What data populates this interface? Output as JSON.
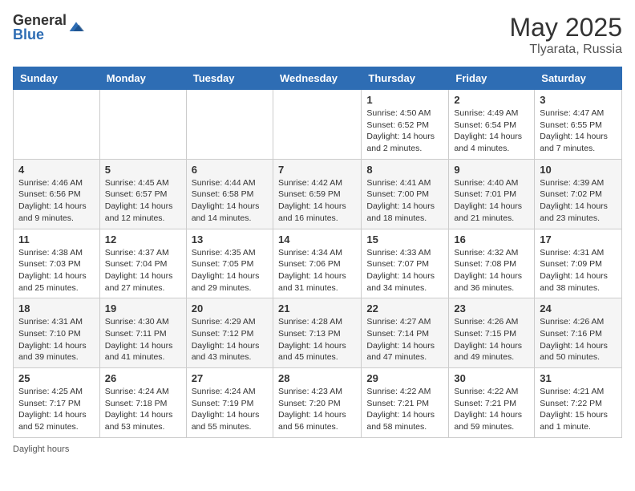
{
  "header": {
    "logo_general": "General",
    "logo_blue": "Blue",
    "month_title": "May 2025",
    "location": "Tlyarata, Russia"
  },
  "days_of_week": [
    "Sunday",
    "Monday",
    "Tuesday",
    "Wednesday",
    "Thursday",
    "Friday",
    "Saturday"
  ],
  "weeks": [
    [
      {
        "day": "",
        "info": ""
      },
      {
        "day": "",
        "info": ""
      },
      {
        "day": "",
        "info": ""
      },
      {
        "day": "",
        "info": ""
      },
      {
        "day": "1",
        "info": "Sunrise: 4:50 AM\nSunset: 6:52 PM\nDaylight: 14 hours and 2 minutes."
      },
      {
        "day": "2",
        "info": "Sunrise: 4:49 AM\nSunset: 6:54 PM\nDaylight: 14 hours and 4 minutes."
      },
      {
        "day": "3",
        "info": "Sunrise: 4:47 AM\nSunset: 6:55 PM\nDaylight: 14 hours and 7 minutes."
      }
    ],
    [
      {
        "day": "4",
        "info": "Sunrise: 4:46 AM\nSunset: 6:56 PM\nDaylight: 14 hours and 9 minutes."
      },
      {
        "day": "5",
        "info": "Sunrise: 4:45 AM\nSunset: 6:57 PM\nDaylight: 14 hours and 12 minutes."
      },
      {
        "day": "6",
        "info": "Sunrise: 4:44 AM\nSunset: 6:58 PM\nDaylight: 14 hours and 14 minutes."
      },
      {
        "day": "7",
        "info": "Sunrise: 4:42 AM\nSunset: 6:59 PM\nDaylight: 14 hours and 16 minutes."
      },
      {
        "day": "8",
        "info": "Sunrise: 4:41 AM\nSunset: 7:00 PM\nDaylight: 14 hours and 18 minutes."
      },
      {
        "day": "9",
        "info": "Sunrise: 4:40 AM\nSunset: 7:01 PM\nDaylight: 14 hours and 21 minutes."
      },
      {
        "day": "10",
        "info": "Sunrise: 4:39 AM\nSunset: 7:02 PM\nDaylight: 14 hours and 23 minutes."
      }
    ],
    [
      {
        "day": "11",
        "info": "Sunrise: 4:38 AM\nSunset: 7:03 PM\nDaylight: 14 hours and 25 minutes."
      },
      {
        "day": "12",
        "info": "Sunrise: 4:37 AM\nSunset: 7:04 PM\nDaylight: 14 hours and 27 minutes."
      },
      {
        "day": "13",
        "info": "Sunrise: 4:35 AM\nSunset: 7:05 PM\nDaylight: 14 hours and 29 minutes."
      },
      {
        "day": "14",
        "info": "Sunrise: 4:34 AM\nSunset: 7:06 PM\nDaylight: 14 hours and 31 minutes."
      },
      {
        "day": "15",
        "info": "Sunrise: 4:33 AM\nSunset: 7:07 PM\nDaylight: 14 hours and 34 minutes."
      },
      {
        "day": "16",
        "info": "Sunrise: 4:32 AM\nSunset: 7:08 PM\nDaylight: 14 hours and 36 minutes."
      },
      {
        "day": "17",
        "info": "Sunrise: 4:31 AM\nSunset: 7:09 PM\nDaylight: 14 hours and 38 minutes."
      }
    ],
    [
      {
        "day": "18",
        "info": "Sunrise: 4:31 AM\nSunset: 7:10 PM\nDaylight: 14 hours and 39 minutes."
      },
      {
        "day": "19",
        "info": "Sunrise: 4:30 AM\nSunset: 7:11 PM\nDaylight: 14 hours and 41 minutes."
      },
      {
        "day": "20",
        "info": "Sunrise: 4:29 AM\nSunset: 7:12 PM\nDaylight: 14 hours and 43 minutes."
      },
      {
        "day": "21",
        "info": "Sunrise: 4:28 AM\nSunset: 7:13 PM\nDaylight: 14 hours and 45 minutes."
      },
      {
        "day": "22",
        "info": "Sunrise: 4:27 AM\nSunset: 7:14 PM\nDaylight: 14 hours and 47 minutes."
      },
      {
        "day": "23",
        "info": "Sunrise: 4:26 AM\nSunset: 7:15 PM\nDaylight: 14 hours and 49 minutes."
      },
      {
        "day": "24",
        "info": "Sunrise: 4:26 AM\nSunset: 7:16 PM\nDaylight: 14 hours and 50 minutes."
      }
    ],
    [
      {
        "day": "25",
        "info": "Sunrise: 4:25 AM\nSunset: 7:17 PM\nDaylight: 14 hours and 52 minutes."
      },
      {
        "day": "26",
        "info": "Sunrise: 4:24 AM\nSunset: 7:18 PM\nDaylight: 14 hours and 53 minutes."
      },
      {
        "day": "27",
        "info": "Sunrise: 4:24 AM\nSunset: 7:19 PM\nDaylight: 14 hours and 55 minutes."
      },
      {
        "day": "28",
        "info": "Sunrise: 4:23 AM\nSunset: 7:20 PM\nDaylight: 14 hours and 56 minutes."
      },
      {
        "day": "29",
        "info": "Sunrise: 4:22 AM\nSunset: 7:21 PM\nDaylight: 14 hours and 58 minutes."
      },
      {
        "day": "30",
        "info": "Sunrise: 4:22 AM\nSunset: 7:21 PM\nDaylight: 14 hours and 59 minutes."
      },
      {
        "day": "31",
        "info": "Sunrise: 4:21 AM\nSunset: 7:22 PM\nDaylight: 15 hours and 1 minute."
      }
    ]
  ],
  "footer": {
    "daylight_label": "Daylight hours"
  }
}
